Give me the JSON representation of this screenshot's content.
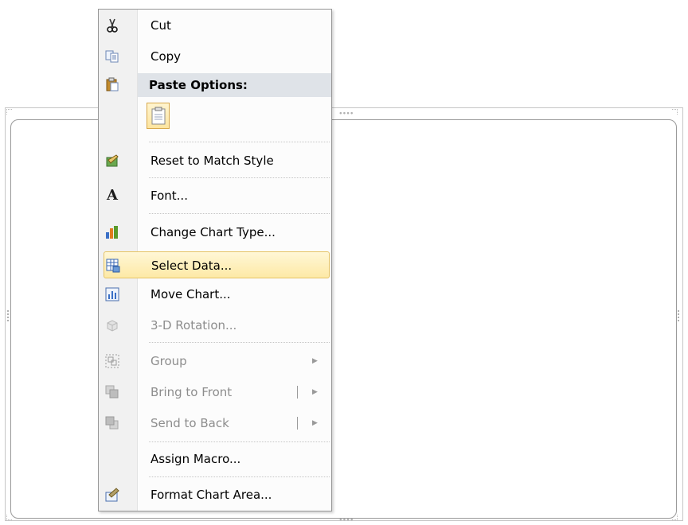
{
  "menu": {
    "cut": "Cut",
    "copy": "Copy",
    "paste_options": "Paste Options:",
    "reset_to_match_style": "Reset to Match Style",
    "font": "Font...",
    "change_chart_type": "Change Chart Type...",
    "select_data": "Select Data...",
    "move_chart": "Move Chart...",
    "rotation_3d": "3-D Rotation...",
    "group": "Group",
    "bring_to_front": "Bring to Front",
    "send_to_back": "Send to Back",
    "assign_macro": "Assign Macro...",
    "format_chart_area": "Format Chart Area..."
  },
  "colors": {
    "highlight_bg": "#fde9a6",
    "highlight_border": "#e5c365",
    "disabled_text": "#8d8d8d",
    "header_bg": "#dfe3e8"
  }
}
